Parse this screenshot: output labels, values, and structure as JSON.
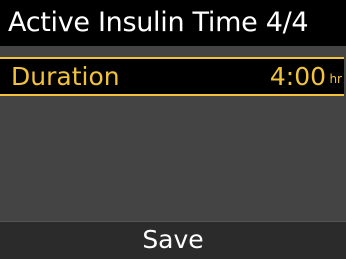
{
  "title": "Active Insulin Time 4/4",
  "setting": {
    "label": "Duration",
    "value": "4:00",
    "unit": "hr"
  },
  "softkey": {
    "label": "Save"
  },
  "colors": {
    "highlight": "#f1c23c",
    "background": "#000000",
    "panel": "#444444",
    "softkey_bar": "#2b2b2b",
    "text": "#ffffff"
  }
}
